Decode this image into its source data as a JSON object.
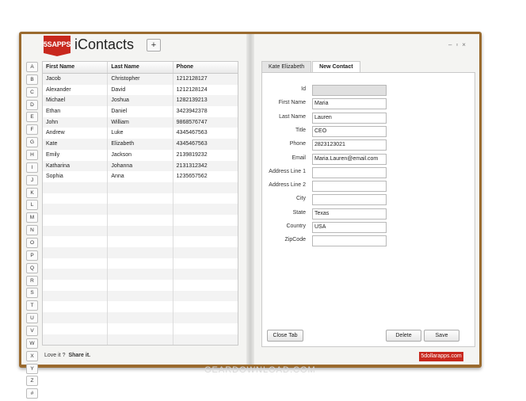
{
  "app": {
    "logo_text": "5SAPPS",
    "title": "iContacts",
    "add_label": "+",
    "window_controls": "–▫×"
  },
  "alphabet": [
    "A",
    "B",
    "C",
    "D",
    "E",
    "F",
    "G",
    "H",
    "I",
    "J",
    "K",
    "L",
    "M",
    "N",
    "O",
    "P",
    "Q",
    "R",
    "S",
    "T",
    "U",
    "V",
    "W",
    "X",
    "Y",
    "Z",
    "#"
  ],
  "contacts_table": {
    "headers": [
      "First Name",
      "Last Name",
      "Phone"
    ],
    "rows": [
      [
        "Jacob",
        "Christopher",
        "1212128127"
      ],
      [
        "Alexander",
        "David",
        "1212128124"
      ],
      [
        "Michael",
        "Joshua",
        "1282139213"
      ],
      [
        "Ethan",
        "Daniel",
        "3423942378"
      ],
      [
        "John",
        "William",
        "9868576747"
      ],
      [
        "Andrew",
        "Luke",
        "4345467563"
      ],
      [
        "Kate",
        "Elizabeth",
        "4345467563"
      ],
      [
        "Emily",
        "Jackson",
        "2139819232"
      ],
      [
        "Katharina",
        "Johanna",
        "2131312342"
      ],
      [
        "Sophia",
        "Anna",
        "1235657562"
      ]
    ],
    "empty_rows": 15
  },
  "footer": {
    "love_it": "Love it ?",
    "share_it": "Share it."
  },
  "tabs": [
    "Kate Elizabeth",
    "New Contact"
  ],
  "form": {
    "fields": [
      {
        "label": "Id",
        "value": ""
      },
      {
        "label": "First Name",
        "value": "Maria"
      },
      {
        "label": "Last Name",
        "value": "Lauren"
      },
      {
        "label": "Title",
        "value": "CEO"
      },
      {
        "label": "Phone",
        "value": "2823123021"
      },
      {
        "label": "Email",
        "value": "Maria.Lauren@email.com"
      },
      {
        "label": "Address Line 1",
        "value": ""
      },
      {
        "label": "Address Line 2",
        "value": ""
      },
      {
        "label": "City",
        "value": ""
      },
      {
        "label": "State",
        "value": "Texas"
      },
      {
        "label": "Country",
        "value": "USA"
      },
      {
        "label": "ZipCode",
        "value": ""
      }
    ]
  },
  "buttons": {
    "close_tab": "Close Tab",
    "delete": "Delete",
    "save": "Save"
  },
  "brand_badge": "5dollarapps.com",
  "watermark": "GEARDOWNLOAD.COM"
}
